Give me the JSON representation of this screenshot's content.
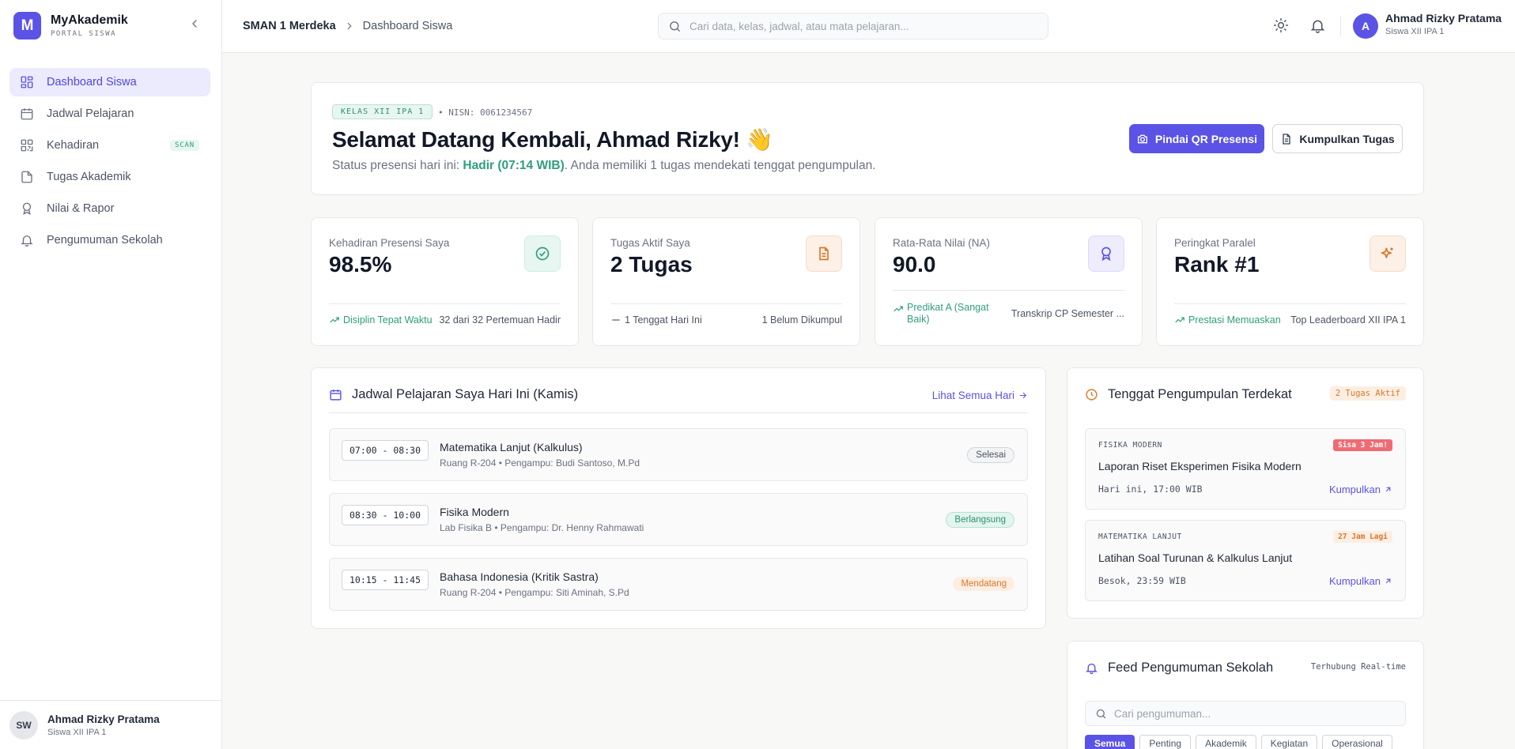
{
  "brand": {
    "letter": "M",
    "name": "MyAkademik",
    "subtitle": "PORTAL SISWA"
  },
  "sidebar": {
    "items": [
      {
        "label": "Dashboard Siswa",
        "icon": "dashboard-icon",
        "active": true
      },
      {
        "label": "Jadwal Pelajaran",
        "icon": "calendar-icon"
      },
      {
        "label": "Kehadiran",
        "icon": "qr-icon",
        "badge": "SCAN"
      },
      {
        "label": "Tugas Akademik",
        "icon": "file-icon"
      },
      {
        "label": "Nilai & Rapor",
        "icon": "award-icon"
      },
      {
        "label": "Pengumuman Sekolah",
        "icon": "bell-icon"
      }
    ],
    "user": {
      "initials": "SW",
      "name": "Ahmad Rizky Pratama",
      "role": "Siswa XII IPA 1"
    }
  },
  "header": {
    "breadcrumb": [
      "SMAN 1 Merdeka",
      "Dashboard Siswa"
    ],
    "search_placeholder": "Cari data, kelas, jadwal, atau mata pelajaran...",
    "user": {
      "initial": "A",
      "name": "Ahmad Rizky Pratama",
      "role": "Siswa XII IPA 1"
    }
  },
  "welcome": {
    "kelas": "KELAS XII IPA 1",
    "nisn": "• NISN: 0061234567",
    "greeting": "Selamat Datang Kembali, Ahmad Rizky! 👋",
    "status_prefix": "Status presensi hari ini: ",
    "status_value": "Hadir (07:14 WIB)",
    "status_suffix": ". Anda memiliki 1 tugas mendekati tenggat pengumpulan.",
    "btn_qr": "Pindai QR Presensi",
    "btn_tugas": "Kumpulkan Tugas"
  },
  "stats": [
    {
      "label": "Kehadiran Presensi Saya",
      "value": "98.5%",
      "icon": "check-circle-icon",
      "foot_left": "Disiplin Tepat Waktu",
      "foot_right": "32 dari 32 Pertemuan Hadir"
    },
    {
      "label": "Tugas Aktif Saya",
      "value": "2 Tugas",
      "icon": "document-icon",
      "foot_left": "1 Tenggat Hari Ini",
      "foot_right": "1 Belum Dikumpul"
    },
    {
      "label": "Rata-Rata Nilai (NA)",
      "value": "90.0",
      "icon": "award-icon",
      "foot_left": "Predikat A (Sangat Baik)",
      "foot_right": "Transkrip CP Semester ..."
    },
    {
      "label": "Peringkat Paralel",
      "value": "Rank #1",
      "icon": "sparkle-icon",
      "foot_left": "Prestasi Memuaskan",
      "foot_right": "Top Leaderboard XII IPA 1"
    }
  ],
  "schedule": {
    "title": "Jadwal Pelajaran Saya Hari Ini (Kamis)",
    "more": "Lihat Semua Hari",
    "rows": [
      {
        "time": "07:00 - 08:30",
        "subject": "Matematika Lanjut (Kalkulus)",
        "room": "Ruang R-204 • Pengampu: Budi Santoso, M.Pd",
        "status": "Selesai"
      },
      {
        "time": "08:30 - 10:00",
        "subject": "Fisika Modern",
        "room": "Lab Fisika B • Pengampu: Dr. Henny Rahmawati",
        "status": "Berlangsung"
      },
      {
        "time": "10:15 - 11:45",
        "subject": "Bahasa Indonesia (Kritik Sastra)",
        "room": "Ruang R-204 • Pengampu: Siti Aminah, S.Pd",
        "status": "Mendatang"
      }
    ]
  },
  "deadlines": {
    "title": "Tenggat Pengumpulan Terdekat",
    "badge": "2 Tugas Aktif",
    "items": [
      {
        "category": "FISIKA MODERN",
        "tag": "Sisa 3 Jam!",
        "title": "Laporan Riset Eksperimen Fisika Modern",
        "time": "Hari ini, 17:00 WIB",
        "link": "Kumpulkan"
      },
      {
        "category": "MATEMATIKA LANJUT",
        "tag": "27 Jam Lagi",
        "title": "Latihan Soal Turunan & Kalkulus Lanjut",
        "time": "Besok, 23:59 WIB",
        "link": "Kumpulkan"
      }
    ]
  },
  "feed": {
    "title": "Feed Pengumuman Sekolah",
    "realtime": "Terhubung Real-time",
    "search_placeholder": "Cari pengumuman...",
    "filters": [
      "Semua",
      "Penting",
      "Akademik",
      "Kegiatan",
      "Operasional"
    ]
  },
  "colors": {
    "accent": "#5b53e6",
    "green": "#2f9e7b",
    "orange": "#d9792c",
    "red": "#ef6b74"
  }
}
